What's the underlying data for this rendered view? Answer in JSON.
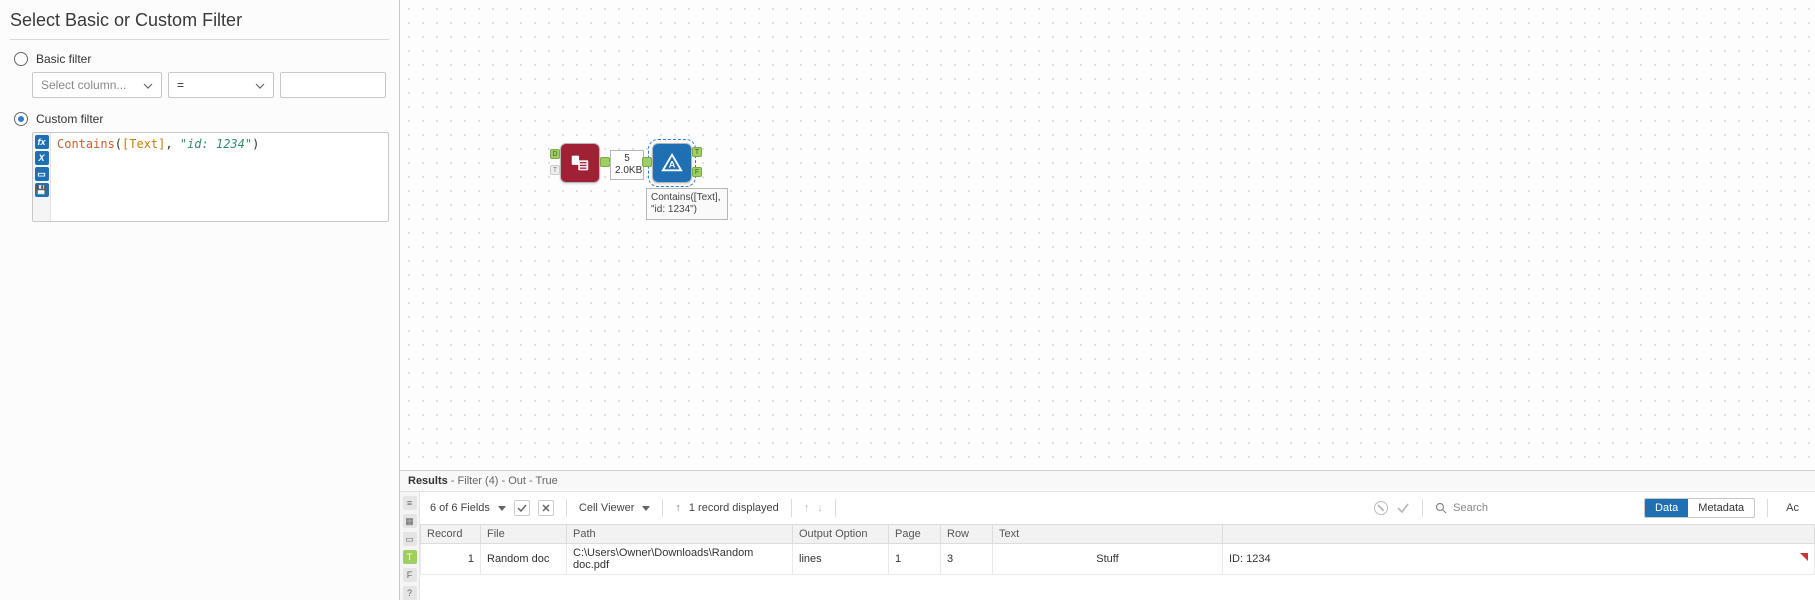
{
  "panel": {
    "title": "Select Basic or Custom Filter",
    "basic_label": "Basic filter",
    "custom_label": "Custom filter",
    "col_placeholder": "Select column...",
    "op_value": "=",
    "val_placeholder": "",
    "expr_fn": "Contains",
    "expr_col": "[Text]",
    "expr_str": "\"id: 1234\""
  },
  "canvas": {
    "record_count": "5",
    "record_size": "2.0KB",
    "anno_line1": "Contains([Text],",
    "anno_line2": "\"id: 1234\")"
  },
  "results_header": {
    "label": "Results",
    "trail": " - Filter (4) - Out - True"
  },
  "toolbar": {
    "fields_text": "6 of 6 Fields",
    "cell_viewer": "Cell Viewer",
    "records_text": "1 record displayed",
    "search_placeholder": "Search",
    "seg_data": "Data",
    "seg_meta": "Metadata",
    "trailing": "Ac"
  },
  "table": {
    "headers": [
      "Record",
      "File",
      "Path",
      "Output Option",
      "Page",
      "Row",
      "Text",
      ""
    ],
    "row": {
      "record": "1",
      "file": "Random doc",
      "path": "C:\\Users\\Owner\\Downloads\\Random doc.pdf",
      "output_option": "lines",
      "page": "1",
      "row": "3",
      "text": "Stuff",
      "id": "ID: 1234"
    }
  }
}
